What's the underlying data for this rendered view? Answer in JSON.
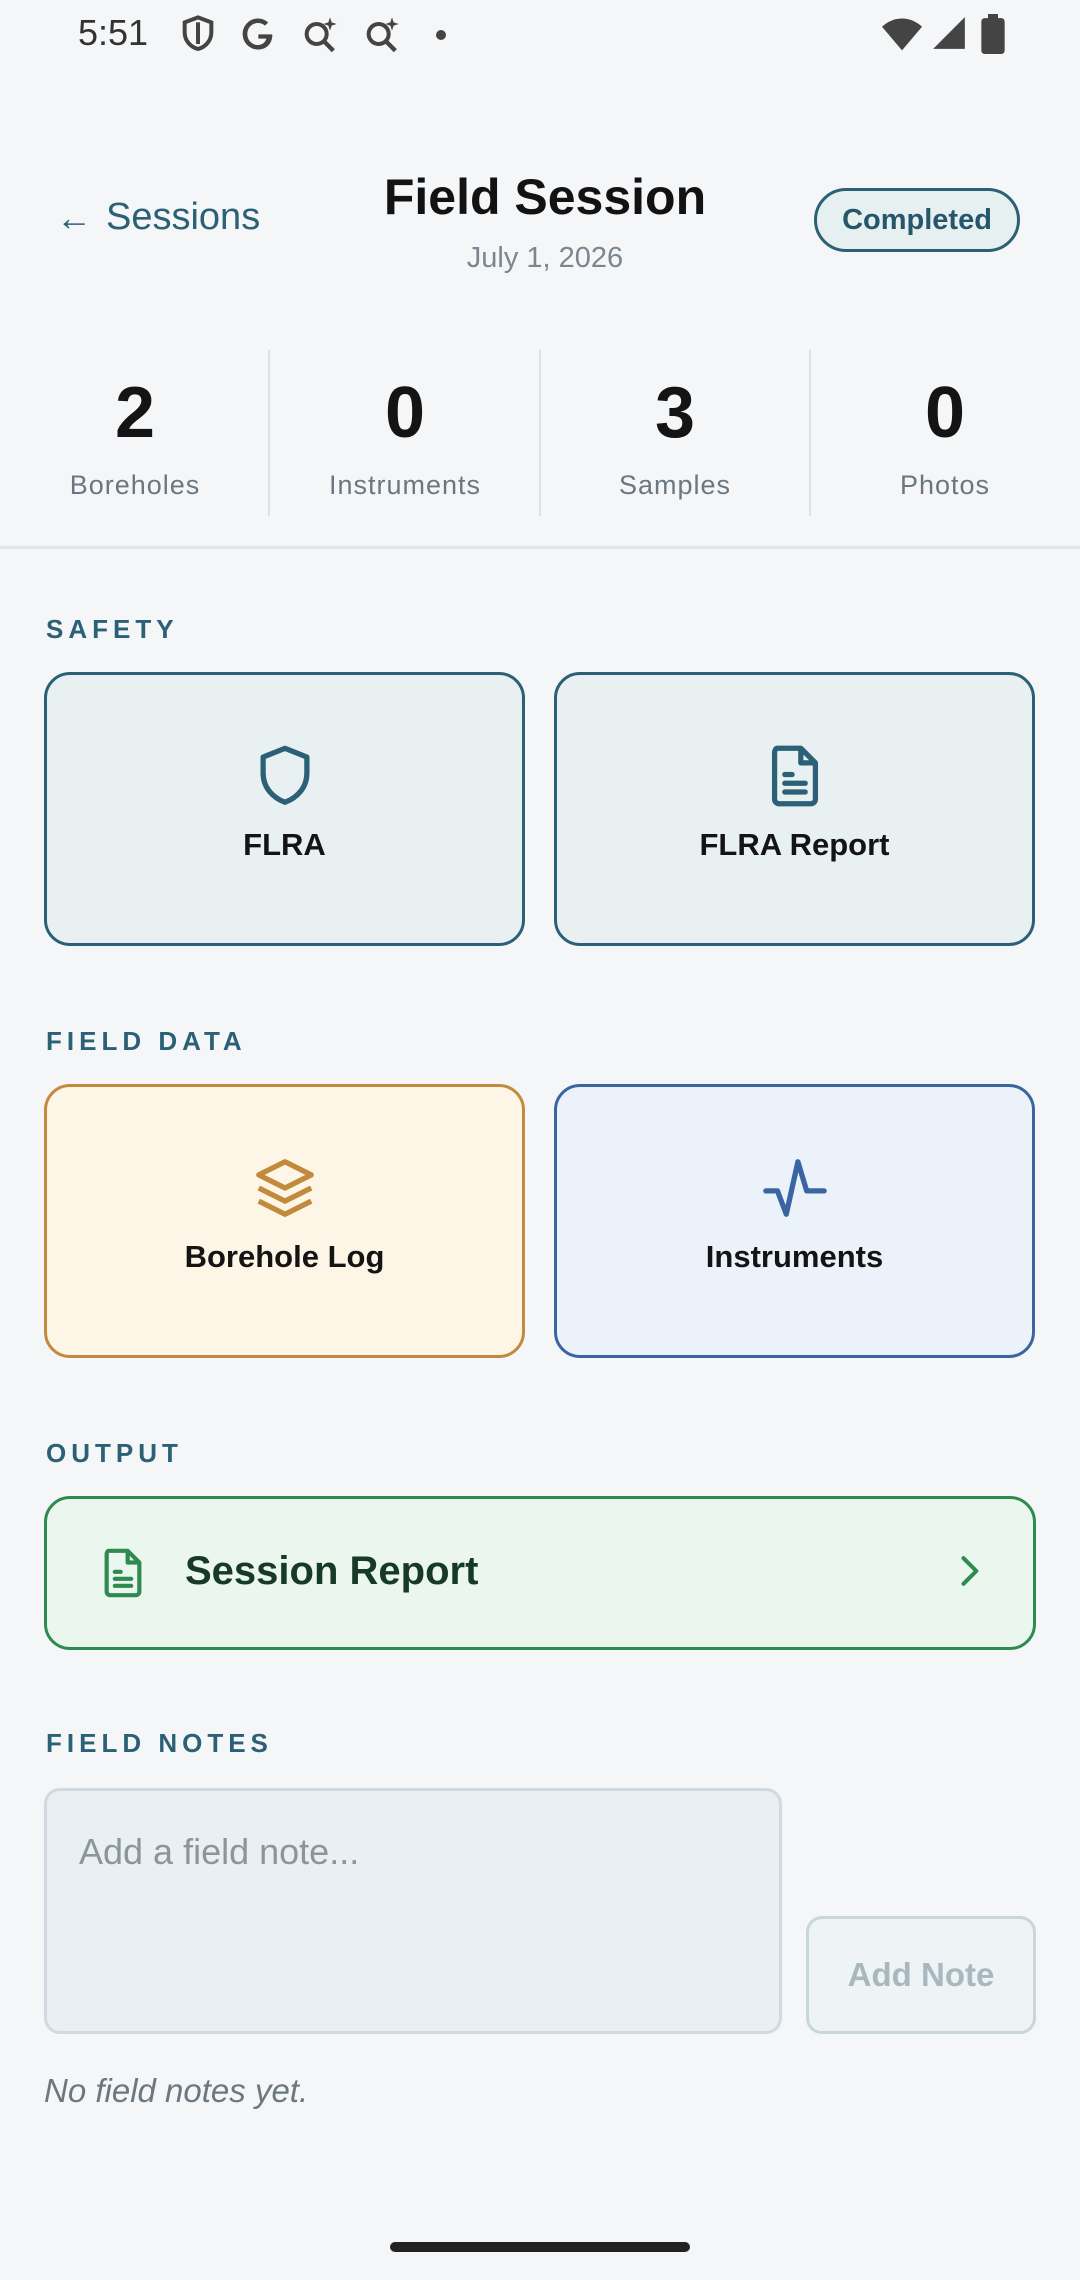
{
  "status_bar": {
    "time": "5:51",
    "left_icons": [
      "shield-status-icon",
      "google-icon",
      "search-sparkle-icon",
      "search-sparkle-icon",
      "dot-icon"
    ],
    "right_icons": [
      "wifi-icon",
      "signal-icon",
      "battery-icon"
    ]
  },
  "header": {
    "back_label": "Sessions",
    "back_icon": "left-arrow-icon",
    "title": "Field Session",
    "date": "July 1, 2026",
    "status": "Completed"
  },
  "stats": [
    {
      "value": "2",
      "label": "Boreholes"
    },
    {
      "value": "0",
      "label": "Instruments"
    },
    {
      "value": "3",
      "label": "Samples"
    },
    {
      "value": "0",
      "label": "Photos"
    }
  ],
  "sections": {
    "safety": {
      "label": "SAFETY",
      "tiles": [
        {
          "label": "FLRA",
          "icon": "shield-icon"
        },
        {
          "label": "FLRA Report",
          "icon": "document-icon"
        }
      ]
    },
    "field_data": {
      "label": "FIELD DATA",
      "tiles": [
        {
          "label": "Borehole Log",
          "icon": "layers-icon"
        },
        {
          "label": "Instruments",
          "icon": "activity-icon"
        }
      ]
    },
    "output": {
      "label": "OUTPUT",
      "report_label": "Session Report",
      "report_icon": "document-icon",
      "chevron_icon": "chevron-right-icon"
    },
    "field_notes": {
      "label": "FIELD NOTES",
      "input_value": "",
      "input_placeholder": "Add a field note...",
      "add_button": "Add Note",
      "empty_text": "No field notes yet."
    }
  },
  "colors": {
    "accent": "#2b6076",
    "borehole": "#c28a3c",
    "instruments": "#3a65a2",
    "report": "#2e8a4e"
  }
}
